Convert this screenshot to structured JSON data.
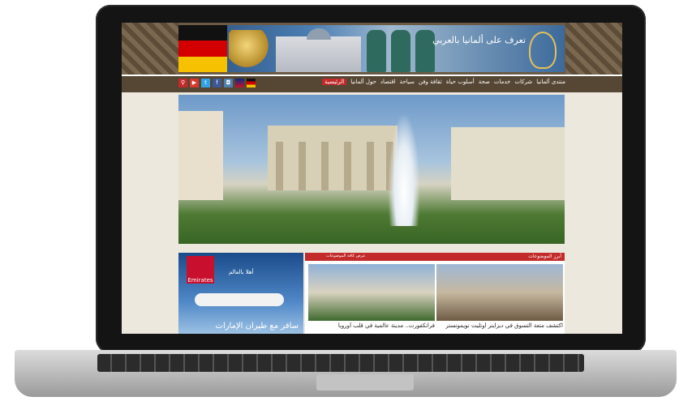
{
  "brand": {
    "text": "تعرف على ألمانيا بالعربي",
    "colors": {
      "primary": "#564634",
      "accent": "#c32a2a",
      "background": "#ece8dd"
    }
  },
  "nav": {
    "items": [
      {
        "label": "الرئيسية",
        "active": true
      },
      {
        "label": "حول ألمانيا"
      },
      {
        "label": "اقتصاد"
      },
      {
        "label": "سياحة"
      },
      {
        "label": "ثقافة وفن"
      },
      {
        "label": "أسلوب حياة"
      },
      {
        "label": "صحة"
      },
      {
        "label": "خدمات"
      },
      {
        "label": "شركات"
      },
      {
        "label": "منتدى ألمانيا"
      }
    ],
    "icons": [
      "german-flag-icon",
      "uk-flag-icon",
      "instagram-icon",
      "facebook-icon",
      "twitter-icon",
      "youtube-icon",
      "search-icon"
    ]
  },
  "hero": {
    "image": "brandenburg-gate-with-fountain"
  },
  "ad": {
    "logo": "Emirates",
    "tagline": "أهلا بالعالم",
    "cta": "سافر مع طيران الإمارات"
  },
  "topics": {
    "title": "أبرز الموضوعات",
    "more": "عرض كافة الموضوعات",
    "stories": [
      {
        "caption": "اكتشف متعة التسوق في ديزاينر أوتليت نويمونستر"
      },
      {
        "caption": "فرانكفورت.. مدينة عالمية في قلب أوروبا"
      }
    ]
  }
}
